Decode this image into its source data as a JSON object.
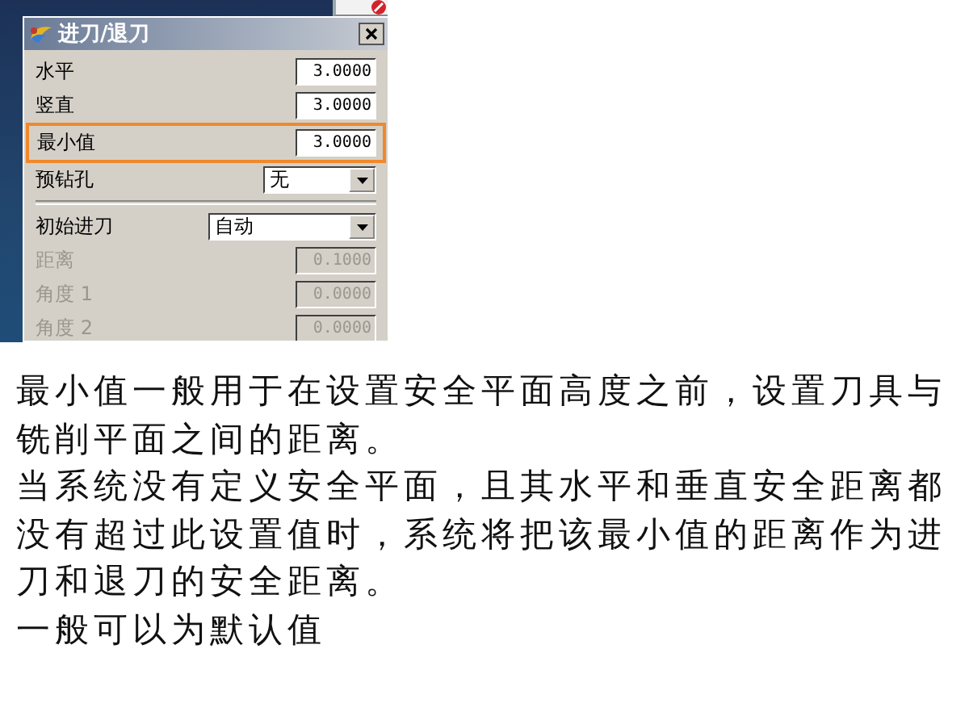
{
  "dialog": {
    "title": "进刀/退刀",
    "rows": [
      {
        "kind": "number",
        "label": "水平",
        "value": "3.0000",
        "disabled": false,
        "highlighted": false
      },
      {
        "kind": "number",
        "label": "竖直",
        "value": "3.0000",
        "disabled": false,
        "highlighted": false
      },
      {
        "kind": "number",
        "label": "最小值",
        "value": "3.0000",
        "disabled": false,
        "highlighted": true
      },
      {
        "kind": "select",
        "label": "预钻孔",
        "value": "无",
        "disabled": false,
        "highlighted": false
      },
      {
        "kind": "separator"
      },
      {
        "kind": "wide-select",
        "label": "初始进刀",
        "value": "自动",
        "disabled": false,
        "highlighted": false
      },
      {
        "kind": "number",
        "label": "距离",
        "value": "0.1000",
        "disabled": true,
        "highlighted": false
      },
      {
        "kind": "number",
        "label": "角度 1",
        "value": "0.0000",
        "disabled": true,
        "highlighted": false
      },
      {
        "kind": "number",
        "label": "角度 2",
        "value": "0.0000",
        "disabled": true,
        "highlighted": false
      }
    ]
  },
  "paragraphs": [
    "最小值一般用于在设置安全平面高度之前，设置刀具与铣削平面之间的距离。",
    "当系统没有定义安全平面，且其水平和垂直安全距离都没有超过此设置值时，系统将把该最小值的距离作为进刀和退刀的安全距离。",
    "一般可以为默认值"
  ]
}
